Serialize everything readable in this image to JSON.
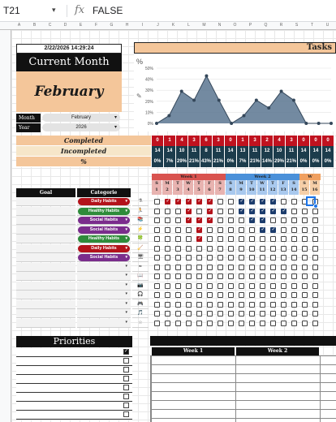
{
  "formula_bar": {
    "cell_ref": "T21",
    "fx": "fx",
    "value": "FALSE"
  },
  "columns": [
    "A",
    "B",
    "C",
    "D",
    "E",
    "F",
    "G",
    "H",
    "I",
    "J",
    "K",
    "L",
    "M",
    "N",
    "O",
    "P",
    "Q",
    "R",
    "S",
    "T",
    "U"
  ],
  "header": {
    "datetime": "2/22/2026 14:29:24",
    "title": "Current Month",
    "month": "February",
    "month_label": "Month",
    "month_value": "February",
    "year_label": "Year",
    "year_value": "2026"
  },
  "tasks_title": "Tasks",
  "chart_data": {
    "type": "area",
    "y_ticks": [
      "50%",
      "40%",
      "30%",
      "20%",
      "10%",
      "0%"
    ],
    "ylim": [
      0,
      50
    ],
    "values": [
      0,
      7,
      29,
      21,
      43,
      21,
      0,
      7,
      21,
      14,
      29,
      21,
      0,
      0,
      0
    ],
    "color": "#5a7590",
    "marker_color": "#34475a"
  },
  "summary": {
    "completed_label": "Completed",
    "incompleted_label": "Incompleted",
    "percent_label": "%",
    "completed": [
      "0",
      "1",
      "4",
      "3",
      "6",
      "3",
      "0",
      "1",
      "3",
      "2",
      "4",
      "3",
      "0",
      "0",
      "0"
    ],
    "incompleted": [
      "14",
      "14",
      "10",
      "11",
      "8",
      "11",
      "14",
      "13",
      "11",
      "12",
      "10",
      "11",
      "14",
      "14",
      "14"
    ],
    "percent": [
      "0%",
      "7%",
      "29%",
      "21%",
      "43%",
      "21%",
      "0%",
      "7%",
      "21%",
      "14%",
      "29%",
      "21%",
      "0%",
      "0%",
      "0%"
    ],
    "completed_color": "#c0121f",
    "incompleted_color": "#1c3c4c",
    "percent_color": "#1c3c4c",
    "label_bg": "#f4c69a",
    "label_bg_light": "#f6e6c9"
  },
  "habits": {
    "goal_header": "Goal",
    "category_header": "Categorie",
    "categories": [
      {
        "label": "Daily Habits",
        "color": "#b3121a"
      },
      {
        "label": "Healthy Habits",
        "color": "#2e8b3a"
      },
      {
        "label": "Social Habits",
        "color": "#7a2d8c"
      },
      {
        "label": "Social Habits",
        "color": "#7a2d8c"
      },
      {
        "label": "Healthy Habits",
        "color": "#2e8b3a"
      },
      {
        "label": "Daily Habits",
        "color": "#b3121a"
      },
      {
        "label": "Social Habits",
        "color": "#7a2d8c"
      }
    ],
    "row_icons": [
      "⚗",
      "🏃",
      "📚",
      "⚡",
      "🍀",
      "🧹",
      "🖥",
      "✒",
      "📖",
      "📷",
      "🎧",
      "🎮",
      "🎵",
      "☆",
      "👚",
      "✈",
      "🎤",
      "🛒"
    ]
  },
  "weeks": [
    {
      "label": "Week 1",
      "color": "#d9534f",
      "light": "#e8b3b0",
      "days": [
        "S",
        "M",
        "T",
        "W",
        "T",
        "F",
        "S"
      ],
      "dates": [
        "1",
        "2",
        "3",
        "4",
        "5",
        "6",
        "7"
      ]
    },
    {
      "label": "Week 2",
      "color": "#4a90d9",
      "light": "#a9c9ee",
      "days": [
        "S",
        "M",
        "T",
        "W",
        "T",
        "F",
        "S"
      ],
      "dates": [
        "8",
        "9",
        "10",
        "11",
        "12",
        "13",
        "14"
      ]
    },
    {
      "label": "W",
      "color": "#f0a060",
      "light": "#f6cfa8",
      "days": [
        "S",
        "M"
      ],
      "dates": [
        "15",
        "16"
      ]
    }
  ],
  "week1_checked": [
    [
      false,
      true,
      true,
      true,
      true,
      true,
      false
    ],
    [
      false,
      false,
      false,
      true,
      false,
      true,
      false
    ],
    [
      false,
      false,
      false,
      true,
      true,
      true,
      false
    ],
    [
      false,
      false,
      false,
      false,
      true,
      false,
      false
    ],
    [
      false,
      false,
      false,
      false,
      true,
      false,
      false
    ],
    [
      false,
      false,
      false,
      false,
      false,
      false,
      false
    ],
    [
      false,
      false,
      false,
      false,
      false,
      false,
      false
    ]
  ],
  "week2_checked": [
    [
      false,
      true,
      true,
      true,
      true,
      false,
      false
    ],
    [
      false,
      true,
      true,
      true,
      true,
      true,
      false
    ],
    [
      false,
      false,
      true,
      true,
      false,
      false,
      false
    ],
    [
      false,
      false,
      false,
      true,
      true,
      false,
      false
    ],
    [
      false,
      false,
      false,
      false,
      false,
      false,
      false
    ],
    [
      false,
      false,
      false,
      false,
      false,
      false,
      false
    ],
    [
      false,
      false,
      false,
      false,
      false,
      false,
      false
    ]
  ],
  "priorities": {
    "title": "Priorities",
    "checked": [
      true,
      false,
      false,
      false,
      false,
      false,
      false,
      false
    ]
  },
  "weekly_table": {
    "headers": [
      "Week 1",
      "Week 2"
    ]
  }
}
